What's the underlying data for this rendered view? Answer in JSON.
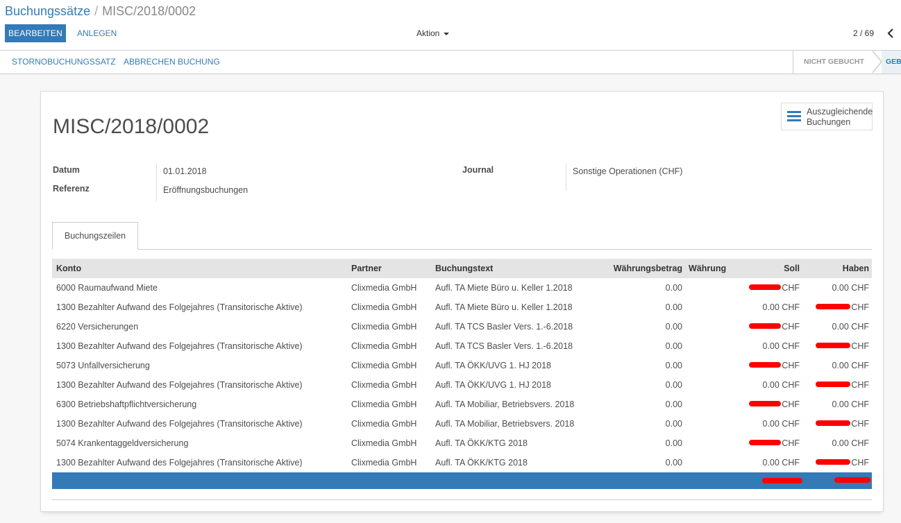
{
  "breadcrumb": {
    "parent": "Buchungssätze",
    "separator": "/",
    "current": "MISC/2018/0002"
  },
  "toolbar": {
    "edit_label": "BEARBEITEN",
    "create_label": "ANLEGEN",
    "action_label": "Aktion"
  },
  "pager": {
    "value": "2 / 69"
  },
  "statusbar": {
    "buttons": [
      "STORNOBUCHUNGSSATZ",
      "ABBRECHEN BUCHUNG"
    ],
    "states": [
      "NICHT GEBUCHT",
      "GEBU"
    ]
  },
  "stat_button": {
    "line1": "Auszugleichende",
    "line2": "Buchungen"
  },
  "record": {
    "title": "MISC/2018/0002",
    "fields": {
      "datum_label": "Datum",
      "datum_value": "01.01.2018",
      "referenz_label": "Referenz",
      "referenz_value": "Eröffnungsbuchungen",
      "journal_label": "Journal",
      "journal_value": "Sonstige Operationen (CHF)"
    }
  },
  "tabs": [
    {
      "label": "Buchungszeilen"
    }
  ],
  "table": {
    "headers": {
      "konto": "Konto",
      "partner": "Partner",
      "text": "Buchungstext",
      "betrag": "Währungsbetrag",
      "waehrung": "Währung",
      "soll": "Soll",
      "haben": "Haben"
    },
    "rows": [
      {
        "konto": "6000 Raumaufwand Miete",
        "partner": "Clixmedia GmbH",
        "text": "Aufl. TA Miete Büro u. Keller 1.2018",
        "betrag": "0.00",
        "waehrung": "",
        "soll": "CHF",
        "haben": "0.00 CHF",
        "soll_redacted": true,
        "haben_redacted": false
      },
      {
        "konto": "1300 Bezahlter Aufwand des Folgejahres (Transitorische Aktive)",
        "partner": "Clixmedia GmbH",
        "text": "Aufl. TA Miete Büro u. Keller 1.2018",
        "betrag": "0.00",
        "waehrung": "",
        "soll": "0.00 CHF",
        "haben": "CHF",
        "soll_redacted": false,
        "haben_redacted": true
      },
      {
        "konto": "6220 Versicherungen",
        "partner": "Clixmedia GmbH",
        "text": "Aufl. TA TCS Basler Vers. 1.-6.2018",
        "betrag": "0.00",
        "waehrung": "",
        "soll": "CHF",
        "haben": "0.00 CHF",
        "soll_redacted": true,
        "haben_redacted": false
      },
      {
        "konto": "1300 Bezahlter Aufwand des Folgejahres (Transitorische Aktive)",
        "partner": "Clixmedia GmbH",
        "text": "Aufl. TA TCS Basler Vers. 1.-6.2018",
        "betrag": "0.00",
        "waehrung": "",
        "soll": "0.00 CHF",
        "haben": "CHF",
        "soll_redacted": false,
        "haben_redacted": true
      },
      {
        "konto": "5073 Unfallversicherung",
        "partner": "Clixmedia GmbH",
        "text": "Aufl. TA ÖKK/UVG 1. HJ 2018",
        "betrag": "0.00",
        "waehrung": "",
        "soll": "CHF",
        "haben": "0.00 CHF",
        "soll_redacted": true,
        "haben_redacted": false
      },
      {
        "konto": "1300 Bezahlter Aufwand des Folgejahres (Transitorische Aktive)",
        "partner": "Clixmedia GmbH",
        "text": "Aufl. TA ÖKK/UVG 1. HJ 2018",
        "betrag": "0.00",
        "waehrung": "",
        "soll": "0.00 CHF",
        "haben": "CHF",
        "soll_redacted": false,
        "haben_redacted": true
      },
      {
        "konto": "6300 Betriebshaftpflichtversicherung",
        "partner": "Clixmedia GmbH",
        "text": "Aufl. TA Mobiliar, Betriebsvers. 2018",
        "betrag": "0.00",
        "waehrung": "",
        "soll": "CHF",
        "haben": "0.00 CHF",
        "soll_redacted": true,
        "haben_redacted": false
      },
      {
        "konto": "1300 Bezahlter Aufwand des Folgejahres (Transitorische Aktive)",
        "partner": "Clixmedia GmbH",
        "text": "Aufl. TA Mobiliar, Betriebsvers. 2018",
        "betrag": "0.00",
        "waehrung": "",
        "soll": "0.00 CHF",
        "haben": "CHF",
        "soll_redacted": false,
        "haben_redacted": true
      },
      {
        "konto": "5074 Krankentaggeldversicherung",
        "partner": "Clixmedia GmbH",
        "text": "Aufl. TA ÖKK/KTG 2018",
        "betrag": "0.00",
        "waehrung": "",
        "soll": "CHF",
        "haben": "0.00 CHF",
        "soll_redacted": true,
        "haben_redacted": false
      },
      {
        "konto": "1300 Bezahlter Aufwand des Folgejahres (Transitorische Aktive)",
        "partner": "Clixmedia GmbH",
        "text": "Aufl. TA ÖKK/KTG 2018",
        "betrag": "0.00",
        "waehrung": "",
        "soll": "0.00 CHF",
        "haben": "CHF",
        "soll_redacted": false,
        "haben_redacted": true
      }
    ]
  },
  "colors": {
    "primary": "#337ab7",
    "redaction": "#ff0000",
    "header_bg": "#e4e4e4"
  },
  "icons": {
    "pager_prev": "chevron-left-icon",
    "stat": "list-icon"
  }
}
